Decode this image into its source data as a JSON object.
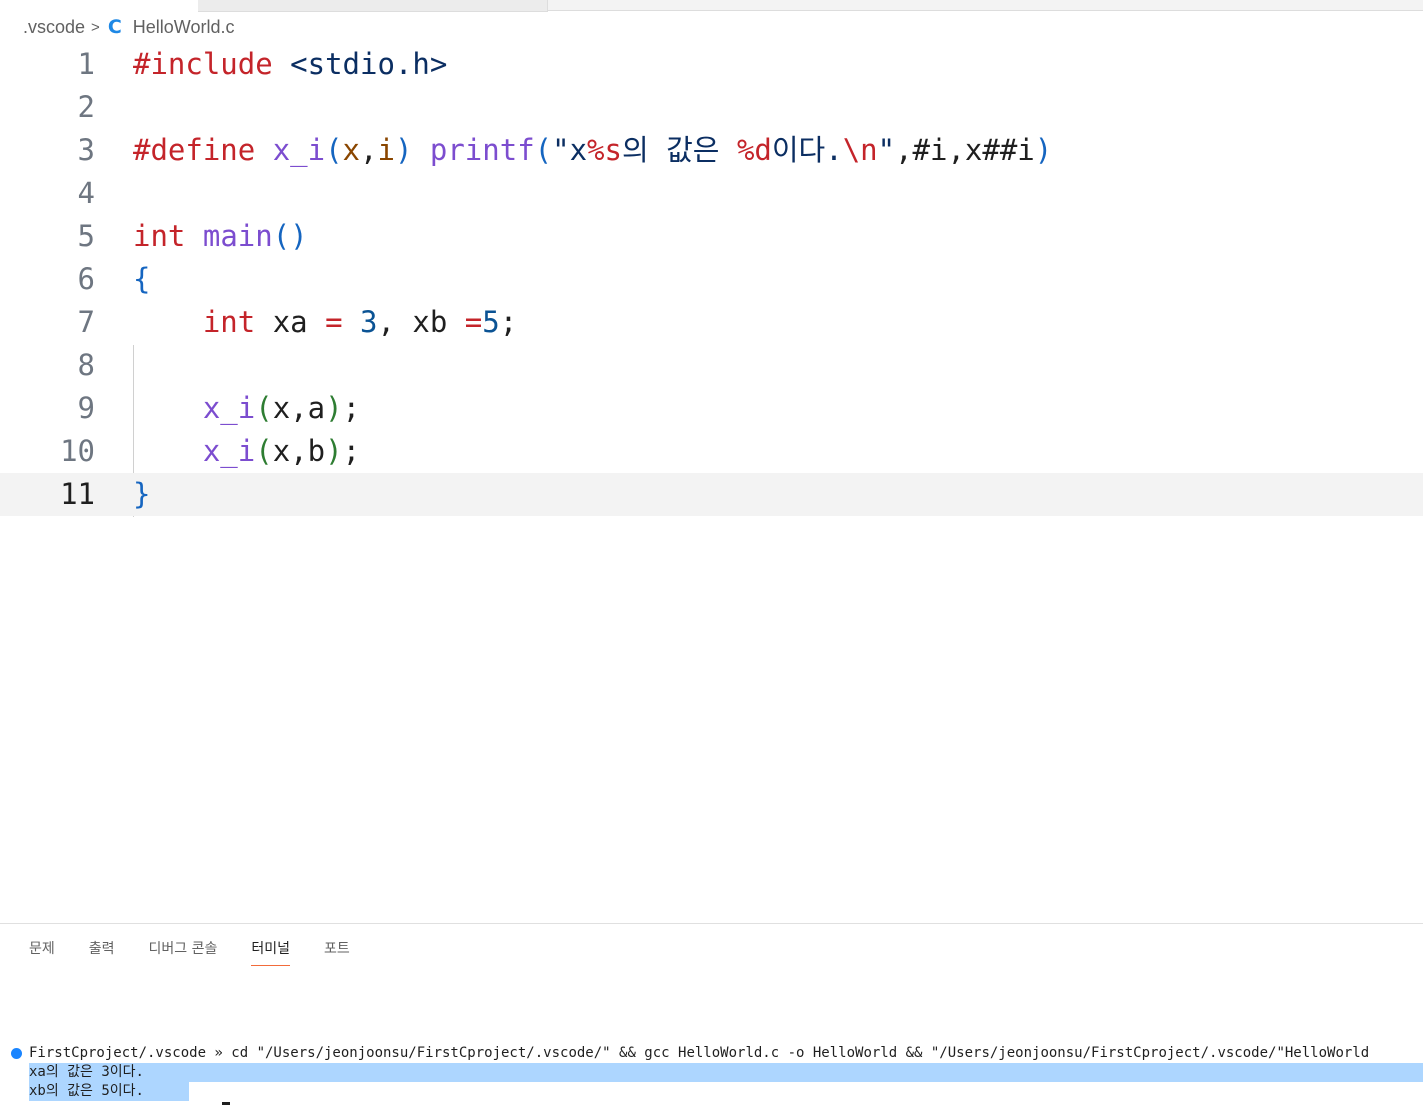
{
  "breadcrumb": {
    "folder": ".vscode",
    "separator": ">",
    "file_icon": "C",
    "file": "HelloWorld.c"
  },
  "editor": {
    "current_line": 11,
    "lines": [
      {
        "n": "1",
        "tokens": [
          {
            "c": "kw",
            "t": "#include"
          },
          {
            "c": "plain",
            "t": " "
          },
          {
            "c": "inc",
            "t": "<stdio.h>"
          }
        ]
      },
      {
        "n": "2",
        "tokens": []
      },
      {
        "n": "3",
        "tokens": [
          {
            "c": "kw",
            "t": "#define"
          },
          {
            "c": "plain",
            "t": " "
          },
          {
            "c": "fn",
            "t": "x_i"
          },
          {
            "c": "pb",
            "t": "("
          },
          {
            "c": "param",
            "t": "x"
          },
          {
            "c": "plain",
            "t": ","
          },
          {
            "c": "param",
            "t": "i"
          },
          {
            "c": "pb",
            "t": ")"
          },
          {
            "c": "plain",
            "t": " "
          },
          {
            "c": "fn",
            "t": "printf"
          },
          {
            "c": "pb",
            "t": "("
          },
          {
            "c": "str",
            "t": "\"x"
          },
          {
            "c": "esc",
            "t": "%s"
          },
          {
            "c": "str",
            "t": "의 값은 "
          },
          {
            "c": "esc",
            "t": "%d"
          },
          {
            "c": "str",
            "t": "이다."
          },
          {
            "c": "esc",
            "t": "\\n"
          },
          {
            "c": "str",
            "t": "\""
          },
          {
            "c": "plain",
            "t": ",#i,x##i"
          },
          {
            "c": "pb",
            "t": ")"
          }
        ]
      },
      {
        "n": "4",
        "tokens": []
      },
      {
        "n": "5",
        "tokens": [
          {
            "c": "kw",
            "t": "int"
          },
          {
            "c": "plain",
            "t": " "
          },
          {
            "c": "fn",
            "t": "main"
          },
          {
            "c": "pb",
            "t": "()"
          }
        ]
      },
      {
        "n": "6",
        "tokens": [
          {
            "c": "pb",
            "t": "{"
          }
        ]
      },
      {
        "n": "7",
        "tokens": [
          {
            "c": "plain",
            "t": "    "
          },
          {
            "c": "kw",
            "t": "int"
          },
          {
            "c": "plain",
            "t": " xa "
          },
          {
            "c": "op",
            "t": "="
          },
          {
            "c": "plain",
            "t": " "
          },
          {
            "c": "num",
            "t": "3"
          },
          {
            "c": "plain",
            "t": ", xb "
          },
          {
            "c": "op",
            "t": "="
          },
          {
            "c": "num",
            "t": "5"
          },
          {
            "c": "plain",
            "t": ";"
          }
        ]
      },
      {
        "n": "8",
        "tokens": []
      },
      {
        "n": "9",
        "tokens": [
          {
            "c": "plain",
            "t": "    "
          },
          {
            "c": "fn",
            "t": "x_i"
          },
          {
            "c": "pg",
            "t": "("
          },
          {
            "c": "plain",
            "t": "x,a"
          },
          {
            "c": "pg",
            "t": ")"
          },
          {
            "c": "plain",
            "t": ";"
          }
        ]
      },
      {
        "n": "10",
        "tokens": [
          {
            "c": "plain",
            "t": "    "
          },
          {
            "c": "fn",
            "t": "x_i"
          },
          {
            "c": "pg",
            "t": "("
          },
          {
            "c": "plain",
            "t": "x,b"
          },
          {
            "c": "pg",
            "t": ")"
          },
          {
            "c": "plain",
            "t": ";"
          }
        ]
      },
      {
        "n": "11",
        "tokens": [
          {
            "c": "pb",
            "t": "}"
          }
        ]
      }
    ]
  },
  "panel": {
    "tabs": [
      {
        "label": "문제",
        "active": false
      },
      {
        "label": "출력",
        "active": false
      },
      {
        "label": "디버그 콘솔",
        "active": false
      },
      {
        "label": "터미널",
        "active": true
      },
      {
        "label": "포트",
        "active": false
      }
    ]
  },
  "terminal": {
    "command_line": "FirstCproject/.vscode » cd \"/Users/jeonjoonsu/FirstCproject/.vscode/\" && gcc HelloWorld.c -o HelloWorld && \"/Users/jeonjoonsu/FirstCproject/.vscode/\"HelloWorld",
    "output": [
      "xa의 값은 3이다.",
      "xb의 값은 5이다."
    ],
    "status_color": "#1a85ff"
  },
  "colors": {
    "keyword": "#c4242a",
    "function": "#7c4dcf",
    "bracket": "#1565c0",
    "selection": "#add6ff",
    "active_tab_underline": "#f26b3a"
  }
}
